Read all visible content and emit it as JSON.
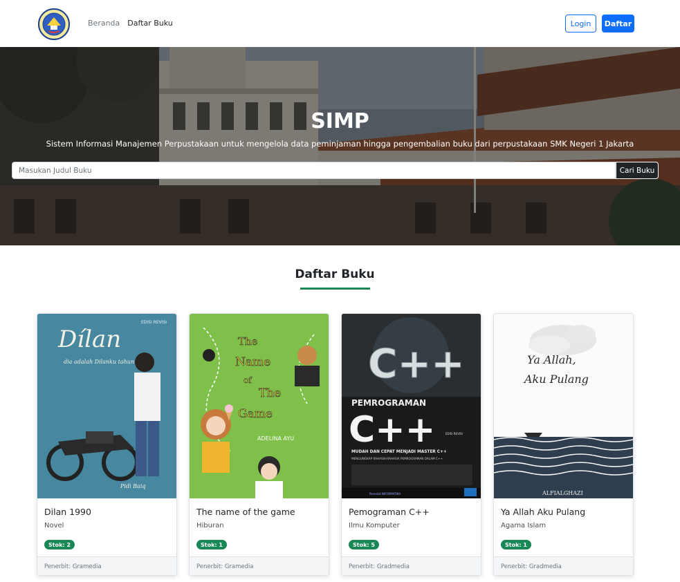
{
  "navbar": {
    "logo_icon": "school-logo-icon",
    "links": [
      {
        "label": "Beranda"
      },
      {
        "label": "Daftar Buku"
      }
    ],
    "login_label": "Login",
    "register_label": "Daftar",
    "accent_color": "#0d6efd"
  },
  "hero": {
    "title": "SIMP",
    "subtitle": "Sistem Informasi Manajemen Perpustakaan untuk mengelola data peminjaman hingga pengembalian buku dari perpustakaan SMK Negeri 1 Jakarta",
    "search_placeholder": "Masukan Judul Buku",
    "search_button_label": "Cari Buku"
  },
  "section": {
    "title": "Daftar Buku",
    "underline_color": "#198754"
  },
  "books": [
    {
      "title": "Dilan 1990",
      "category": "Novel",
      "stock_label": "Stok: 2",
      "publisher_label": "Penerbit: Gramedia",
      "cover": {
        "icon": "dilan-cover-image",
        "title_text": "Dílan",
        "subtitle_text": "dia adalah Dilanku tahun 1990",
        "edition_text": "EDISI REVISI",
        "author_text": "Pidi Baiq"
      }
    },
    {
      "title": "The name of the game",
      "category": "Hiburan",
      "stock_label": "Stok: 1",
      "publisher_label": "Penerbit: Gramedia",
      "cover": {
        "icon": "the-name-of-the-game-cover-image",
        "line1": "The",
        "line2": "Name",
        "line3": "of",
        "line4": "The",
        "line5": "Game",
        "author_text": "ADELINA AYU"
      }
    },
    {
      "title": "Pemograman C++",
      "category": "Ilmu Komputer",
      "stock_label": "Stok: 5",
      "publisher_label": "Penerbit: Gradmedia",
      "cover": {
        "icon": "pemrograman-cpp-cover-image",
        "logo_text": "C++",
        "heading_text": "PEMROGRAMAN",
        "big_text": "C++",
        "edition_text": "EDISI REVISI",
        "tagline_text": "MUDAH DAN CEPAT MENJADI MASTER C++",
        "sub_tagline_text": "MENGUNGKAP RAHASIA-RAHASIA PEMROGRAMAN DALAM C++",
        "publisher_text": "Penerbit INFORMATIKA"
      }
    },
    {
      "title": "Ya Allah Aku Pulang",
      "category": "Agama Islam",
      "stock_label": "Stok: 1",
      "publisher_label": "Penerbit: Gradmedia",
      "cover": {
        "icon": "ya-allah-aku-pulang-cover-image",
        "title_line1": "Ya Allah,",
        "title_line2": "Aku Pulang",
        "author_text": "ALFIALGHAZI"
      }
    }
  ],
  "colors": {
    "badge": "#198754",
    "primary": "#0d6efd",
    "dark_button": "#212529"
  }
}
